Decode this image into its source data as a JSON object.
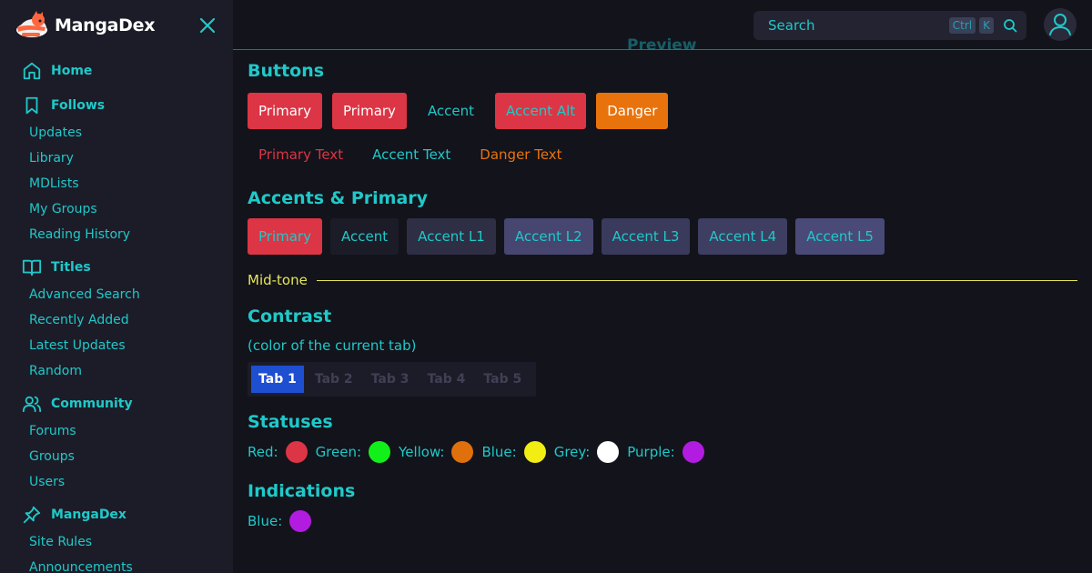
{
  "brand": {
    "name": "MangaDex"
  },
  "sidebar": {
    "sections": [
      {
        "label": "Home",
        "icon": "home-icon",
        "items": []
      },
      {
        "label": "Follows",
        "icon": "bookmark-icon",
        "items": [
          "Updates",
          "Library",
          "MDLists",
          "My Groups",
          "Reading History"
        ]
      },
      {
        "label": "Titles",
        "icon": "book-open-icon",
        "items": [
          "Advanced Search",
          "Recently Added",
          "Latest Updates",
          "Random"
        ]
      },
      {
        "label": "Community",
        "icon": "users-icon",
        "items": [
          "Forums",
          "Groups",
          "Users"
        ]
      },
      {
        "label": "MangaDex",
        "icon": "pin-icon",
        "items": [
          "Site Rules",
          "Announcements"
        ]
      }
    ]
  },
  "header": {
    "search_placeholder": "Search",
    "shortcut_ctrl": "Ctrl",
    "shortcut_key": "K",
    "faded_title": "Preview"
  },
  "buttons": {
    "heading": "Buttons",
    "filled": [
      {
        "label": "Primary",
        "bg": "#dc3545",
        "color": "#ffffff"
      },
      {
        "label": "Primary",
        "bg": "#dc3545",
        "color": "#ffffff"
      },
      {
        "label": "Accent",
        "bg": "transparent",
        "color": "#1fc9c9"
      },
      {
        "label": "Accent Alt",
        "bg": "#dc3545",
        "color": "#1fc9c9"
      },
      {
        "label": "Danger",
        "bg": "#e8730d",
        "color": "#ffffff"
      }
    ],
    "text": [
      {
        "label": "Primary Text",
        "color": "#dc3545"
      },
      {
        "label": "Accent Text",
        "color": "#1fc9c9"
      },
      {
        "label": "Danger Text",
        "color": "#e8730d"
      }
    ]
  },
  "accents": {
    "heading": "Accents & Primary",
    "items": [
      {
        "label": "Primary",
        "bg": "#dc3545"
      },
      {
        "label": "Accent",
        "bg": "#1c1c28"
      },
      {
        "label": "Accent L1",
        "bg": "#2e2e44"
      },
      {
        "label": "Accent L2",
        "bg": "#464670"
      },
      {
        "label": "Accent L3",
        "bg": "#3a3a5c"
      },
      {
        "label": "Accent L4",
        "bg": "#3e3e62"
      },
      {
        "label": "Accent L5",
        "bg": "#4a4a78"
      }
    ]
  },
  "midtone": {
    "label": "Mid-tone"
  },
  "contrast": {
    "heading": "Contrast",
    "subtitle": "(color of the current tab)",
    "tabs": [
      "Tab 1",
      "Tab 2",
      "Tab 3",
      "Tab 4",
      "Tab 5"
    ],
    "active_tab": 0
  },
  "statuses": {
    "heading": "Statuses",
    "items": [
      {
        "label": "Red:",
        "color": "#dc3545"
      },
      {
        "label": "Green:",
        "color": "#12f01a"
      },
      {
        "label": "Yellow:",
        "color": "#e0700c"
      },
      {
        "label": "Blue:",
        "color": "#f2ee14"
      },
      {
        "label": "Grey:",
        "color": "#ffffff"
      },
      {
        "label": "Purple:",
        "color": "#b11ce0"
      }
    ]
  },
  "indications": {
    "heading": "Indications",
    "items": [
      {
        "label": "Blue:",
        "color": "#b11ce0"
      }
    ]
  },
  "colors": {
    "accent": "#1fc9c9",
    "sidebar_bg": "#1c1c28",
    "page_bg": "#13131b"
  }
}
